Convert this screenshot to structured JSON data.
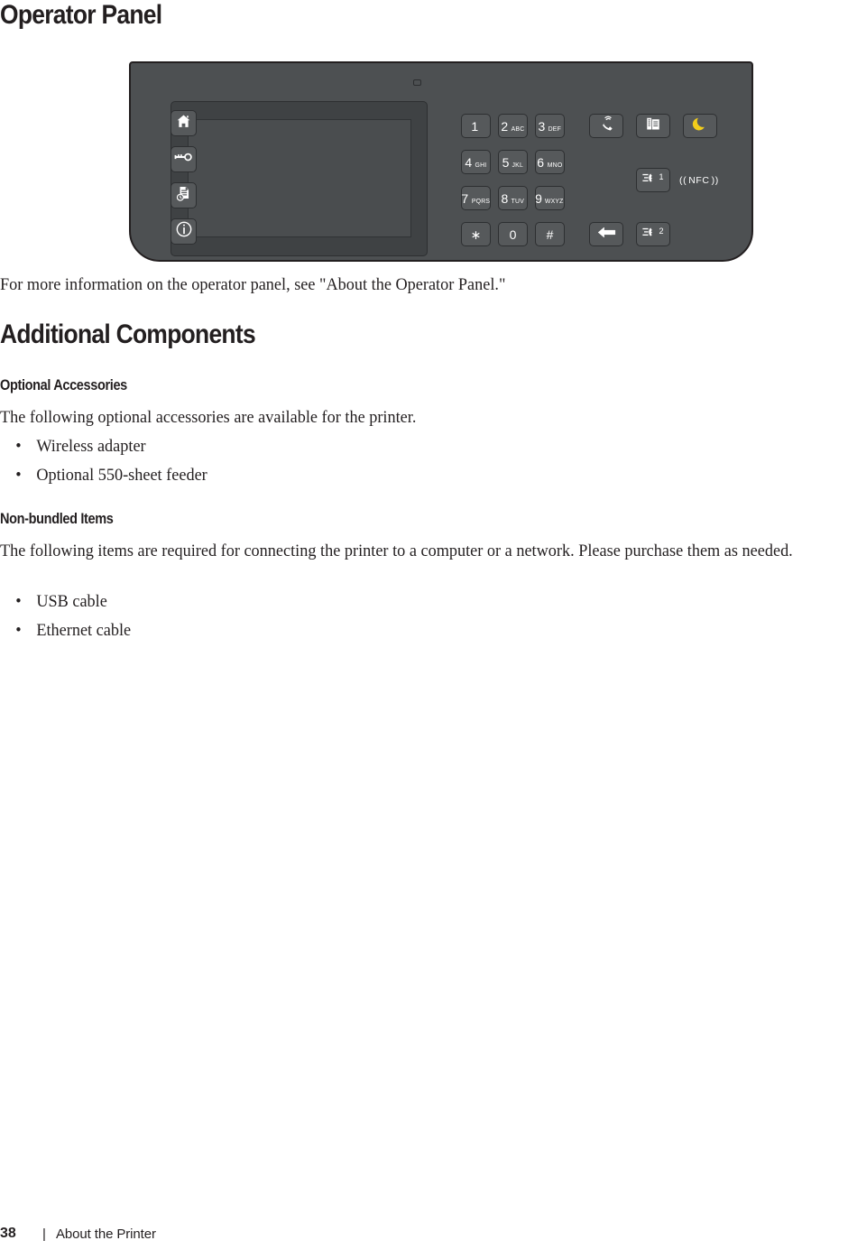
{
  "document": {
    "section_heading": "Operator Panel",
    "intro_paragraph": "For more information on the operator panel, see \"About the Operator Panel.\"",
    "additional_components_heading": "Additional Components",
    "optional_accessories": {
      "heading": "Optional Accessories",
      "intro": "The following optional accessories are available for the printer.",
      "items": [
        "Wireless adapter",
        "Optional 550-sheet feeder"
      ]
    },
    "non_bundled_items": {
      "heading": "Non-bundled Items",
      "intro": "The following items are required for connecting the printer to a computer or a network. Please purchase them as needed.",
      "items": [
        "USB cable",
        "Ethernet cable"
      ]
    },
    "bullet_glyph": "•"
  },
  "footer": {
    "page_number": "38",
    "separator": "|",
    "section_name": "About the Printer"
  },
  "operator_panel": {
    "left_buttons": [
      {
        "name": "home-button",
        "icon": "home-icon"
      },
      {
        "name": "login-logout-button",
        "icon": "key-icon"
      },
      {
        "name": "job-status-button",
        "icon": "job-status-icon"
      },
      {
        "name": "information-button",
        "icon": "info-icon"
      }
    ],
    "keypad": [
      {
        "digit": "1",
        "letters": ""
      },
      {
        "digit": "2",
        "letters": "ABC"
      },
      {
        "digit": "3",
        "letters": "DEF"
      },
      {
        "digit": "4",
        "letters": "GHI"
      },
      {
        "digit": "5",
        "letters": "JKL"
      },
      {
        "digit": "6",
        "letters": "MNO"
      },
      {
        "digit": "7",
        "letters": "PQRS"
      },
      {
        "digit": "8",
        "letters": "TUV"
      },
      {
        "digit": "9",
        "letters": "WXYZ"
      },
      {
        "digit": "∗",
        "letters": ""
      },
      {
        "digit": "0",
        "letters": ""
      },
      {
        "digit": "#",
        "letters": ""
      }
    ],
    "right_buttons": [
      {
        "name": "on-hook-dial-button",
        "icon": "phone-handset-icon"
      },
      {
        "name": "copy-button",
        "icon": "copy-documents-icon"
      },
      {
        "name": "power-saver-button",
        "icon": "moon-icon"
      }
    ],
    "speed_dial_1_label": "1",
    "speed_dial_2_label": "2",
    "nfc_label": "NFC",
    "nfc_left_wave": "((",
    "nfc_right_wave": "))",
    "colors": {
      "panel_body": "#4d5052",
      "button_face": "#56595b",
      "outline": "#231f20",
      "screen": "#4a4d4f",
      "moon_yellow": "#f2cd1b",
      "icon_white": "#ffffff"
    }
  }
}
